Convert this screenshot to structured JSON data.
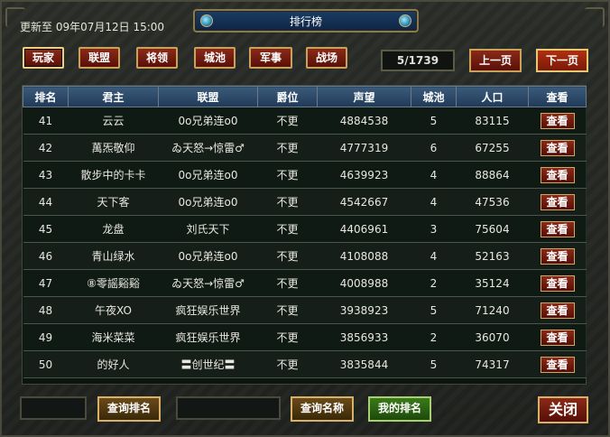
{
  "window": {
    "title": "排行榜",
    "update_text": "更新至 09年07月12日 15:00"
  },
  "tabs": [
    {
      "label": "玩家",
      "active": true
    },
    {
      "label": "联盟"
    },
    {
      "label": "将领"
    },
    {
      "label": "城池"
    },
    {
      "label": "军事"
    },
    {
      "label": "战场"
    }
  ],
  "pagination": {
    "page": "5/1739",
    "prev_label": "上一页",
    "next_label": "下一页"
  },
  "table": {
    "headers": [
      "排名",
      "君主",
      "联盟",
      "爵位",
      "声望",
      "城池",
      "人口",
      "查看"
    ],
    "view_label": "查看",
    "rows": [
      {
        "rank": "41",
        "lord": "云云",
        "alliance": "0o兄弟连o0",
        "title": "不更",
        "prestige": "4884538",
        "cities": "5",
        "population": "83115"
      },
      {
        "rank": "42",
        "lord": "萬炁敬仰",
        "alliance": "ゐ天怒→惊雷♂",
        "title": "不更",
        "prestige": "4777319",
        "cities": "6",
        "population": "67255"
      },
      {
        "rank": "43",
        "lord": "散步中的卡卡",
        "alliance": "0o兄弟连o0",
        "title": "不更",
        "prestige": "4639923",
        "cities": "4",
        "population": "88864"
      },
      {
        "rank": "44",
        "lord": "天下客",
        "alliance": "0o兄弟连o0",
        "title": "不更",
        "prestige": "4542667",
        "cities": "4",
        "population": "47536"
      },
      {
        "rank": "45",
        "lord": "龙盘",
        "alliance": "刘氏天下",
        "title": "不更",
        "prestige": "4406961",
        "cities": "3",
        "population": "75604"
      },
      {
        "rank": "46",
        "lord": "青山绿水",
        "alliance": "0o兄弟连o0",
        "title": "不更",
        "prestige": "4108088",
        "cities": "4",
        "population": "52163"
      },
      {
        "rank": "47",
        "lord": "⑧零謡谿谿",
        "alliance": "ゐ天怒→惊雷♂",
        "title": "不更",
        "prestige": "4008988",
        "cities": "2",
        "population": "35124"
      },
      {
        "rank": "48",
        "lord": "午夜XO",
        "alliance": "疯狂娱乐世界",
        "title": "不更",
        "prestige": "3938923",
        "cities": "5",
        "population": "71240"
      },
      {
        "rank": "49",
        "lord": "海米菜菜",
        "alliance": "疯狂娱乐世界",
        "title": "不更",
        "prestige": "3856933",
        "cities": "2",
        "population": "36070"
      },
      {
        "rank": "50",
        "lord": "的好人",
        "alliance": "〓创世纪〓",
        "title": "不更",
        "prestige": "3835844",
        "cities": "5",
        "population": "74317"
      }
    ]
  },
  "footer": {
    "rank_input": "",
    "rank_query_label": "查询排名",
    "name_input": "",
    "name_query_label": "查询名称",
    "my_rank_label": "我的排名",
    "close_label": "关闭"
  }
}
